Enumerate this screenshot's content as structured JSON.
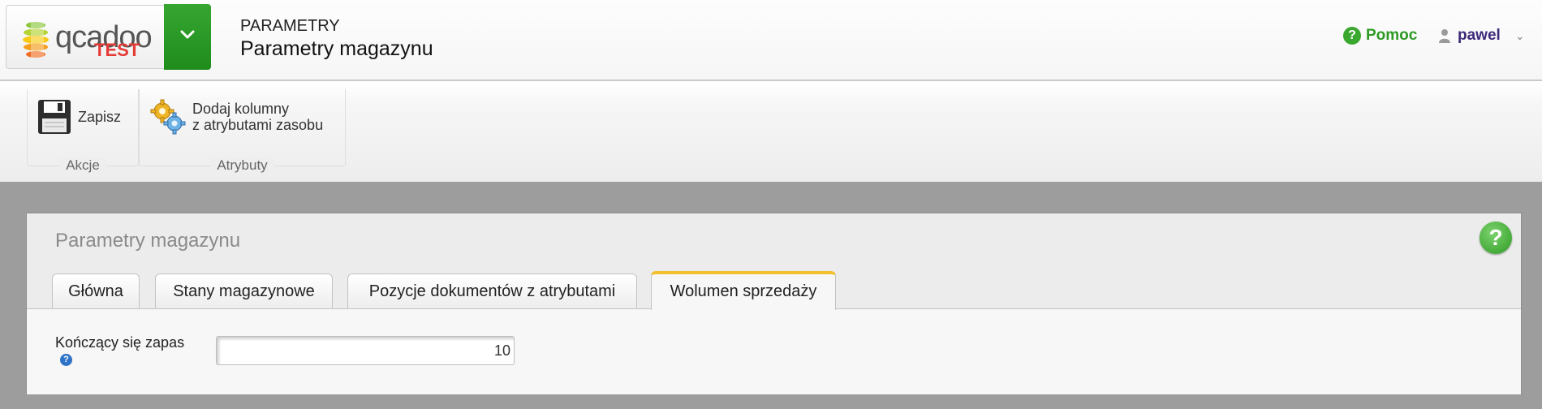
{
  "header": {
    "logo": {
      "word": "qcadoo",
      "badge": "TEST"
    },
    "section": "PARAMETRY",
    "title": "Parametry magazynu",
    "help_label": "Pomoc",
    "user_label": "pawel"
  },
  "ribbon": {
    "groups": [
      {
        "label": "Akcje",
        "buttons": [
          {
            "label": "Zapisz",
            "icon": "floppy-disk-icon"
          }
        ]
      },
      {
        "label": "Atrybuty",
        "buttons": [
          {
            "label_line1": "Dodaj kolumny",
            "label_line2": "z atrybutami zasobu",
            "icon": "gears-icon"
          }
        ]
      }
    ]
  },
  "panel": {
    "title": "Parametry magazynu",
    "tabs": [
      {
        "label": "Główna",
        "active": false
      },
      {
        "label": "Stany magazynowe",
        "active": false
      },
      {
        "label": "Pozycje dokumentów z atrybutami",
        "active": false
      },
      {
        "label": "Wolumen sprzedaży",
        "active": true
      }
    ],
    "fields": [
      {
        "label": "Kończący się zapas",
        "value": "10"
      }
    ]
  },
  "colors": {
    "accent_green": "#2e9a24",
    "tab_active_border": "#f2c02e",
    "user_color": "#3d2a7a"
  }
}
